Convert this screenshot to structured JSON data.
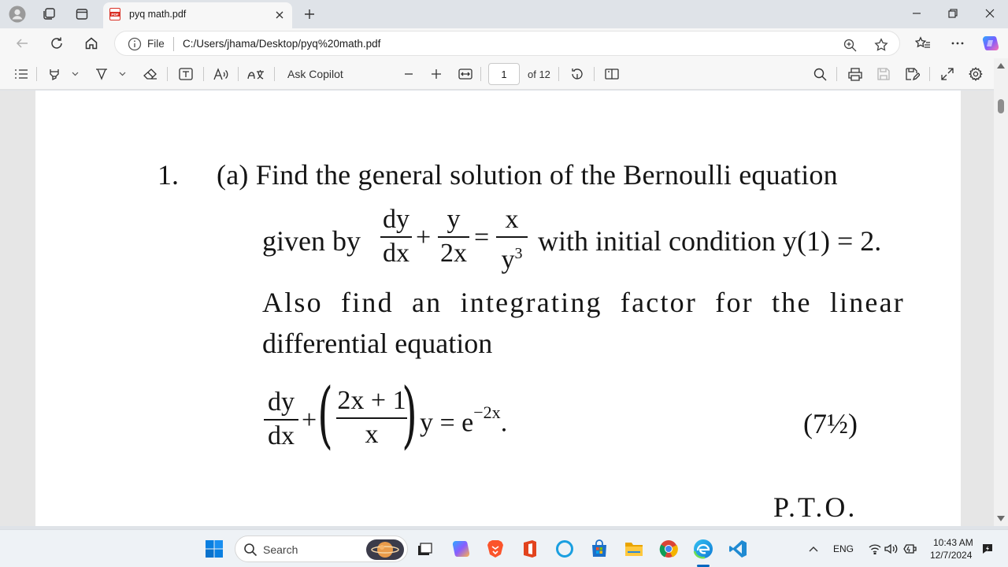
{
  "browser": {
    "tab_title": "pyq math.pdf",
    "address": {
      "scheme_label": "File",
      "url": "C:/Users/jhama/Desktop/pyq%20math.pdf"
    }
  },
  "pdf_toolbar": {
    "ask_copilot_label": "Ask Copilot",
    "current_page": "1",
    "page_count_label": "of 12"
  },
  "document": {
    "question_number": "1.",
    "line1": "(a) Find the general solution of the Bernoulli equation",
    "given_by": "given by",
    "eq1": {
      "num1": "dy",
      "den1": "dx",
      "plus": "+",
      "num2": "y",
      "den2": "2x",
      "equals": "=",
      "num3": "x",
      "den3": "y",
      "den3_exp": "3"
    },
    "initial_condition": "with initial condition y(1) = 2.",
    "line3": "Also find an integrating factor for the linear",
    "line4": "differential equation",
    "eq2": {
      "num1": "dy",
      "den1": "dx",
      "plus": "+",
      "inner_num": "2x + 1",
      "inner_den": "x",
      "rhs": "y = e",
      "rhs_exp": "−2x",
      "period": "."
    },
    "marks": "(7½)",
    "pto": "P.T.O."
  },
  "taskbar": {
    "search_label": "Search",
    "language": "ENG",
    "time": "10:43 AM",
    "date": "12/7/2024"
  },
  "colors": {
    "accent": "#0067c0",
    "pdf_red": "#d93025",
    "edge_blue": "#0f7bd6",
    "vscode_blue": "#1f8ad2"
  }
}
